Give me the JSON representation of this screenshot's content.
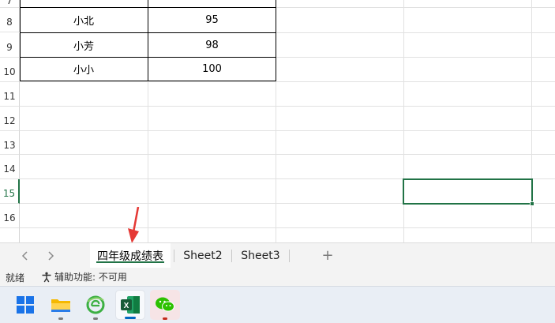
{
  "grid": {
    "rows": [
      {
        "num": "7",
        "name": "",
        "score": ""
      },
      {
        "num": "8",
        "name": "小北",
        "score": "95"
      },
      {
        "num": "9",
        "name": "小芳",
        "score": "98"
      },
      {
        "num": "10",
        "name": "小小",
        "score": "100"
      },
      {
        "num": "11",
        "name": "",
        "score": ""
      },
      {
        "num": "12",
        "name": "",
        "score": ""
      },
      {
        "num": "13",
        "name": "",
        "score": ""
      },
      {
        "num": "14",
        "name": "",
        "score": ""
      },
      {
        "num": "15",
        "name": "",
        "score": ""
      },
      {
        "num": "16",
        "name": "",
        "score": ""
      }
    ],
    "active_row": "15"
  },
  "sheet_tabs": {
    "prev_icon": "chevron-left-icon",
    "next_icon": "chevron-right-icon",
    "tabs": [
      {
        "label": "四年级成绩表",
        "active": true
      },
      {
        "label": "Sheet2",
        "active": false
      },
      {
        "label": "Sheet3",
        "active": false
      }
    ],
    "add_icon": "+"
  },
  "status": {
    "ready": "就绪",
    "accessibility": "辅助功能: 不可用"
  },
  "taskbar": {
    "apps": [
      "windows-start-icon",
      "file-explorer-icon",
      "browser-icon",
      "excel-icon",
      "wechat-icon"
    ]
  },
  "colors": {
    "accent": "#217346",
    "annotation": "#e53935"
  }
}
